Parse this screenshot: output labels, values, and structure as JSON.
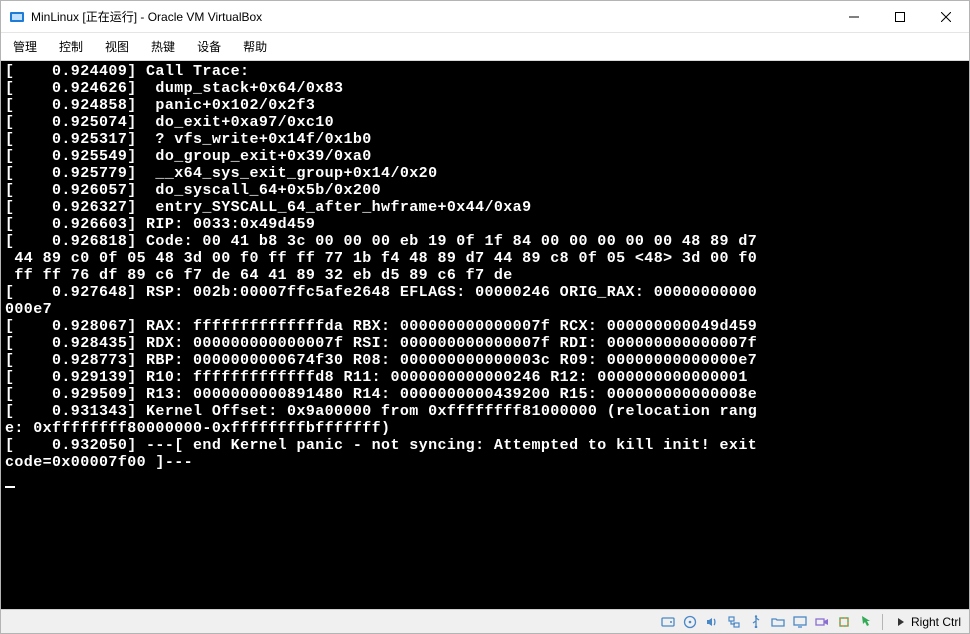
{
  "window": {
    "title": "MinLinux [正在运行] - Oracle VM VirtualBox"
  },
  "menu": {
    "items": [
      "管理",
      "控制",
      "视图",
      "热键",
      "设备",
      "帮助"
    ]
  },
  "terminal": {
    "lines": [
      "[    0.924409] Call Trace:",
      "[    0.924626]  dump_stack+0x64/0x83",
      "[    0.924858]  panic+0x102/0x2f3",
      "[    0.925074]  do_exit+0xa97/0xc10",
      "[    0.925317]  ? vfs_write+0x14f/0x1b0",
      "[    0.925549]  do_group_exit+0x39/0xa0",
      "[    0.925779]  __x64_sys_exit_group+0x14/0x20",
      "[    0.926057]  do_syscall_64+0x5b/0x200",
      "[    0.926327]  entry_SYSCALL_64_after_hwframe+0x44/0xa9",
      "[    0.926603] RIP: 0033:0x49d459",
      "[    0.926818] Code: 00 41 b8 3c 00 00 00 eb 19 0f 1f 84 00 00 00 00 00 48 89 d7",
      " 44 89 c0 0f 05 48 3d 00 f0 ff ff 77 1b f4 48 89 d7 44 89 c8 0f 05 <48> 3d 00 f0",
      " ff ff 76 df 89 c6 f7 de 64 41 89 32 eb d5 89 c6 f7 de",
      "[    0.927648] RSP: 002b:00007ffc5afe2648 EFLAGS: 00000246 ORIG_RAX: 00000000000",
      "000e7",
      "[    0.928067] RAX: ffffffffffffffda RBX: 000000000000007f RCX: 000000000049d459",
      "[    0.928435] RDX: 000000000000007f RSI: 000000000000007f RDI: 000000000000007f",
      "[    0.928773] RBP: 0000000000674f30 R08: 000000000000003c R09: 00000000000000e7",
      "[    0.929139] R10: fffffffffffffd8 R11: 0000000000000246 R12: 0000000000000001",
      "[    0.929509] R13: 0000000000891480 R14: 0000000000439200 R15: 000000000000008e",
      "[    0.931343] Kernel Offset: 0x9a00000 from 0xffffffff81000000 (relocation rang",
      "e: 0xffffffff80000000-0xffffffffbfffffff)",
      "[    0.932050] ---[ end Kernel panic - not syncing: Attempted to kill init! exit",
      "code=0x00007f00 ]---"
    ]
  },
  "status": {
    "hostkey": "Right Ctrl"
  }
}
